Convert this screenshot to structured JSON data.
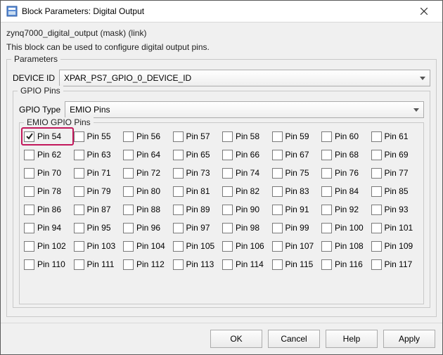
{
  "window": {
    "title": "Block Parameters: Digital Output"
  },
  "mask_line": "zynq7000_digital_output (mask) (link)",
  "description": "This block can be used to configure digital output pins.",
  "parameters_legend": "Parameters",
  "device_id": {
    "label": "DEVICE ID",
    "value": "XPAR_PS7_GPIO_0_DEVICE_ID"
  },
  "gpio_pins_legend": "GPIO Pins",
  "gpio_type": {
    "label": "GPIO Type",
    "value": "EMIO Pins"
  },
  "emio_pins": {
    "legend": "EMIO GPIO Pins",
    "start": 54,
    "end": 117,
    "checked": [
      54
    ]
  },
  "buttons": {
    "ok": "OK",
    "cancel": "Cancel",
    "help": "Help",
    "apply": "Apply"
  }
}
